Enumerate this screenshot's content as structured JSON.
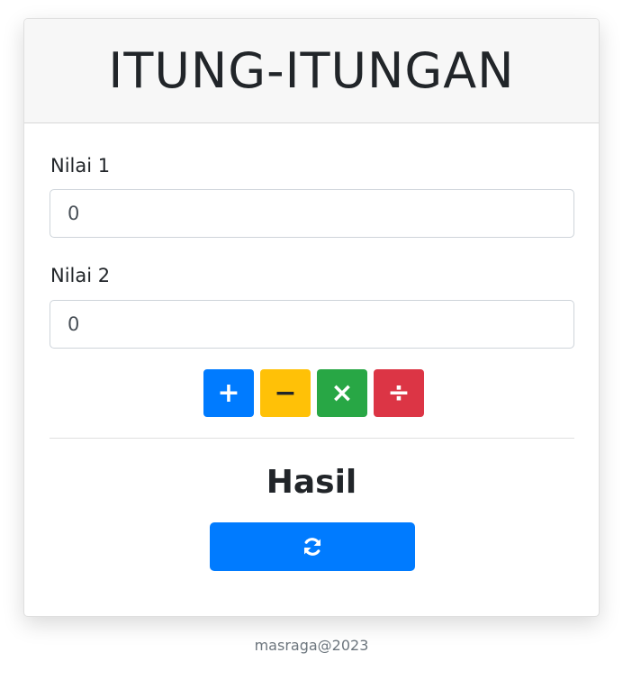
{
  "header": {
    "title": "ITUNG-ITUNGAN"
  },
  "form": {
    "nilai1": {
      "label": "Nilai 1",
      "value": "0"
    },
    "nilai2": {
      "label": "Nilai 2",
      "value": "0"
    }
  },
  "operations": [
    {
      "symbol": "+",
      "icon": "plus-icon",
      "color": "#007bff",
      "text_color": "#ffffff"
    },
    {
      "symbol": "−",
      "icon": "minus-icon",
      "color": "#ffc107",
      "text_color": "#212529"
    },
    {
      "symbol": "×",
      "icon": "times-icon",
      "color": "#28a745",
      "text_color": "#ffffff"
    },
    {
      "symbol": "÷",
      "icon": "divide-icon",
      "color": "#dc3545",
      "text_color": "#ffffff"
    }
  ],
  "result": {
    "title": "Hasil",
    "reset_icon": "refresh-icon",
    "reset_color": "#007bff"
  },
  "footer": {
    "text": "masraga@2023"
  }
}
